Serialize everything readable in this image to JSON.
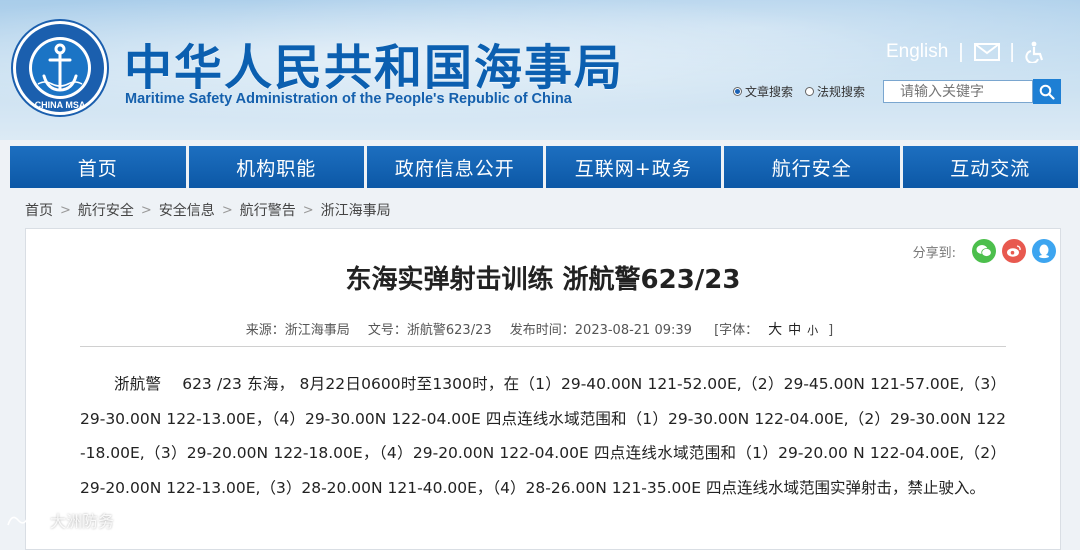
{
  "header": {
    "title_cn": "中华人民共和国海事局",
    "title_en": "Maritime Safety Administration of the People's Republic of China",
    "logo_text": "CHINA MSA",
    "english_link": "English",
    "email_icon": "mail-icon",
    "accessibility_icon": "wheelchair-icon"
  },
  "search": {
    "option_docs": "文章搜索",
    "option_laws": "法规搜索",
    "placeholder": "请输入关键字",
    "selected": "文章搜索"
  },
  "nav": {
    "items": [
      "首页",
      "机构职能",
      "政府信息公开",
      "互联网+政务",
      "航行安全",
      "互动交流"
    ]
  },
  "breadcrumb": [
    "首页",
    "航行安全",
    "安全信息",
    "航行警告",
    "浙江海事局"
  ],
  "article": {
    "share_label": "分享到:",
    "title": "东海实弹射击训练 浙航警623/23",
    "meta": {
      "source": "来源：浙江海事局",
      "doc_no": "文号：浙航警623/23",
      "publish_time": "发布时间：2023-08-21 09:39",
      "font_label": "[字体：",
      "font_large": "大",
      "font_medium": "中",
      "font_small": "小",
      "font_close": "]"
    },
    "body": "浙航警　 623 /23 东海， 8月22日0600时至1300时，在（1）29-40.00N 121-52.00E,（2）29-45.00N 121-57.00E,（3）29-30.00N 122-13.00E，（4）29-30.00N 122-04.00E 四点连线水域范围和（1）29-30.00N 122-04.00E,（2）29-30.00N 122-18.00E,（3）29-20.00N 122-18.00E，（4）29-20.00N 122-04.00E 四点连线水域范围和（1）29-20.00 N 122-04.00E,（2）29-20.00N 122-13.00E,（3）28-20.00N 121-40.00E，（4）28-26.00N 121-35.00E 四点连线水域范围实弹射击，禁止驶入。"
  },
  "watermark": "大洲防务",
  "colors": {
    "nav_blue": "#0c58a6",
    "title_blue": "#0b5fb0",
    "wechat": "#4cbf4c",
    "weibo": "#e8594f",
    "qq": "#3da5f0"
  }
}
